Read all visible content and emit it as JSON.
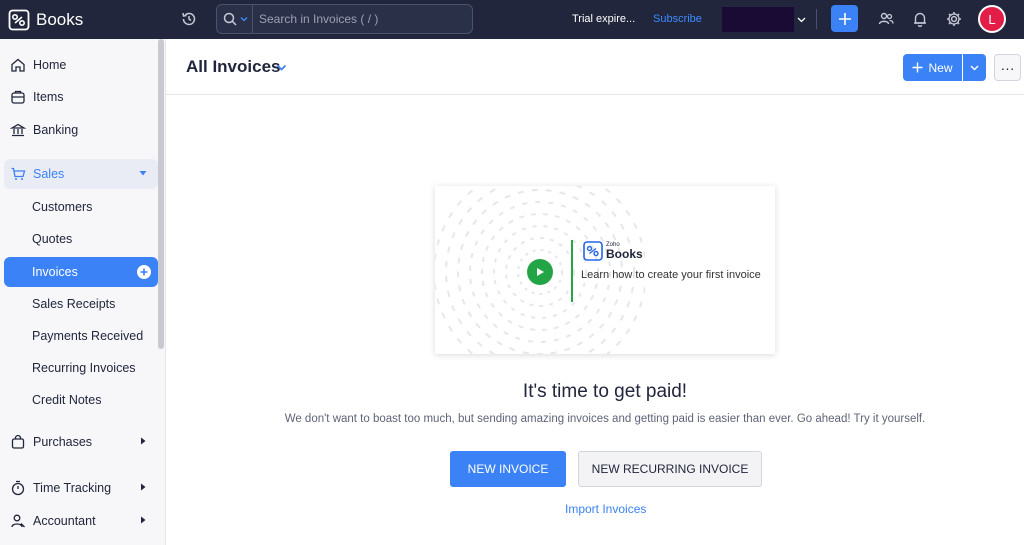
{
  "app": {
    "brand_name": "Books"
  },
  "topbar": {
    "search_placeholder": "Search in Invoices ( / )",
    "trial_text": "Trial expire...",
    "subscribe_label": "Subscribe",
    "avatar_initial": "L"
  },
  "sidebar": {
    "items": [
      {
        "label": "Home",
        "icon": "home-icon"
      },
      {
        "label": "Items",
        "icon": "items-icon"
      },
      {
        "label": "Banking",
        "icon": "bank-icon"
      },
      {
        "label": "Sales",
        "icon": "cart-icon",
        "expanded": true
      },
      {
        "label": "Customers"
      },
      {
        "label": "Quotes"
      },
      {
        "label": "Invoices",
        "active": true
      },
      {
        "label": "Sales Receipts"
      },
      {
        "label": "Payments Received"
      },
      {
        "label": "Recurring Invoices"
      },
      {
        "label": "Credit Notes"
      },
      {
        "label": "Purchases",
        "icon": "bag-icon"
      },
      {
        "label": "Time Tracking",
        "icon": "stopwatch-icon"
      },
      {
        "label": "Accountant",
        "icon": "accountant-icon"
      }
    ]
  },
  "header": {
    "title": "All Invoices",
    "new_label": "New",
    "more_label": "···"
  },
  "main": {
    "video_card": {
      "logo_small": "Zoho",
      "logo_large": "Books",
      "description": "Learn how to create your first invoice"
    },
    "headline": "It's time to get paid!",
    "subtext": "We don't want to boast too much, but sending amazing invoices and getting paid is easier than ever. Go ahead! Try it yourself.",
    "primary_button": "NEW INVOICE",
    "secondary_button": "NEW RECURRING INVOICE",
    "import_link": "Import Invoices"
  },
  "colors": {
    "topbar_bg": "#21263c",
    "accent": "#3b82f6",
    "play_green": "#22a447",
    "avatar": "#e11d48"
  }
}
